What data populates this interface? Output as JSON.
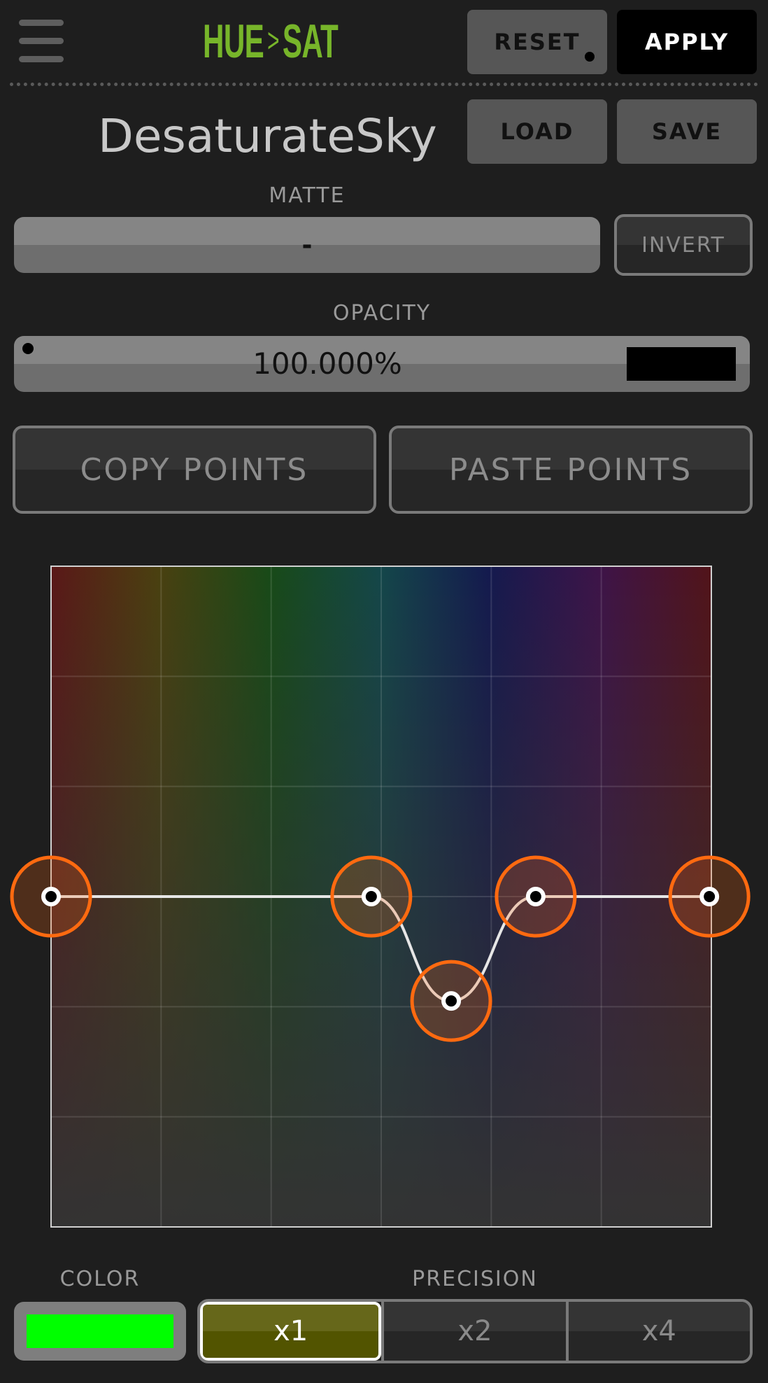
{
  "header": {
    "logo_hue": "HUE",
    "logo_sep": ">",
    "logo_sat": "SAT",
    "reset_label": "RESET",
    "apply_label": "APPLY",
    "menu_icon": "hamburger-menu-icon"
  },
  "preset": {
    "name": "DesaturateSky",
    "load_label": "LOAD",
    "save_label": "SAVE"
  },
  "matte": {
    "label": "MATTE",
    "value": "-",
    "invert_label": "INVERT"
  },
  "opacity": {
    "label": "OPACITY",
    "value": "100.000%"
  },
  "points": {
    "copy_label": "COPY POINTS",
    "paste_label": "PASTE POINTS"
  },
  "curve": {
    "x_range": [
      0,
      1
    ],
    "y_range": [
      0,
      1
    ],
    "grid_divisions": 6,
    "handle_color": "#ff6a10",
    "line_color": "#e6e6e6",
    "points": [
      {
        "x": 0.0,
        "y": 0.5
      },
      {
        "x": 0.485,
        "y": 0.5
      },
      {
        "x": 0.606,
        "y": 0.342
      },
      {
        "x": 0.734,
        "y": 0.5
      },
      {
        "x": 0.997,
        "y": 0.5
      }
    ]
  },
  "color": {
    "label": "COLOR",
    "swatch": "#00ff00"
  },
  "precision": {
    "label": "PRECISION",
    "options": [
      "x1",
      "x2",
      "x4"
    ],
    "selected": "x1"
  }
}
